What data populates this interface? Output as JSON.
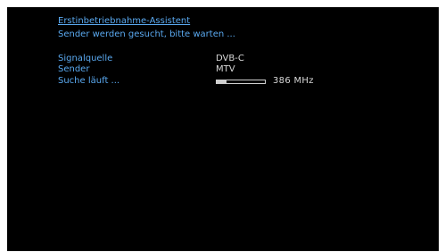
{
  "wizard": {
    "title": "Erstinbetriebnahme-Assistent",
    "status": "Sender werden gesucht, bitte warten ..."
  },
  "scan": {
    "rows": [
      {
        "label": "Signalquelle",
        "value": "DVB-C"
      },
      {
        "label": "Sender",
        "value": "MTV"
      },
      {
        "label": "Suche läuft ..."
      }
    ],
    "progress": 0.2,
    "frequency": "386 MHz"
  },
  "colors": {
    "label_text": "#5aa9f0",
    "value_text": "#d8d8d8",
    "background": "#000000"
  }
}
